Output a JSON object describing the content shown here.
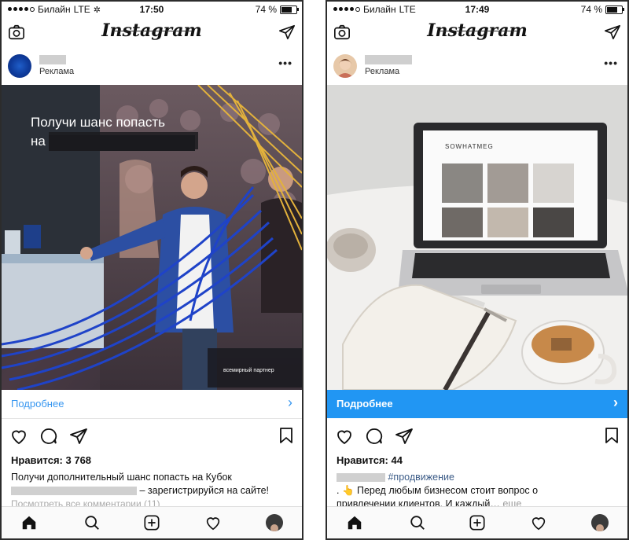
{
  "left_phone": {
    "status": {
      "carrier": "Билайн",
      "network": "LTE",
      "time": "17:50",
      "battery": "74 %",
      "battery_level": 0.74
    },
    "header": {
      "logo": "Instagram"
    },
    "post": {
      "sponsored": "Реклама",
      "photo_headline_line1": "Получи шанс попасть",
      "photo_headline_line2": "на",
      "photo_footer": "всемирный партнер",
      "cta_label": "Подробнее",
      "cta_arrow": "›",
      "more": "•••",
      "likes": "Нравится: 3 768",
      "caption_line1": "Получи дополнительный шанс попасть на Кубок",
      "caption_line2": "– зарегистрируйся на сайте!",
      "comments": "Посмотреть все комментарии (11)"
    },
    "icons": {
      "camera": "camera-icon",
      "direct": "paper-plane-icon"
    }
  },
  "right_phone": {
    "status": {
      "carrier": "Билайн",
      "network": "LTE",
      "time": "17:49",
      "battery": "74 %",
      "battery_level": 0.74
    },
    "header": {
      "logo": "Instagram"
    },
    "post": {
      "sponsored": "Реклама",
      "laptop_site": "SOWHATMEG",
      "cta_label": "Подробнее",
      "cta_arrow": "›",
      "more": "•••",
      "likes": "Нравится: 44",
      "hashtag": "#продвижение",
      "caption_line1": ". 👆 Перед любым бизнесом стоит вопрос о",
      "caption_line2": "привлечении клиентов. И каждый…",
      "caption_more": "еще"
    },
    "colors": {
      "cta_background": "#2196f3"
    }
  }
}
